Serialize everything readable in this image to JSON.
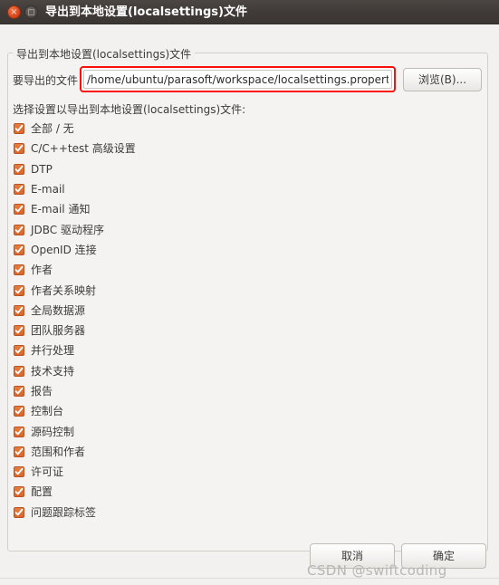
{
  "window": {
    "title": "导出到本地设置(localsettings)文件",
    "close_icon": "close-icon",
    "maximize_icon": "maximize-icon",
    "close_glyph": "×"
  },
  "group": {
    "legend": "导出到本地设置(localsettings)文件"
  },
  "path_field": {
    "label": "要导出的文件",
    "value": "/home/ubuntu/parasoft/workspace/localsettings.properties",
    "placeholder": "",
    "highlight_color": "#fa0f0a"
  },
  "browse_button": {
    "label": "浏览(B)..."
  },
  "instruction": "选择设置以导出到本地设置(localsettings)文件:",
  "checkboxes": {
    "accent_color": "#d9662c",
    "items": [
      {
        "label": "全部 / 无",
        "checked": true
      },
      {
        "label": "C/C++test 高级设置",
        "checked": true
      },
      {
        "label": "DTP",
        "checked": true
      },
      {
        "label": "E-mail",
        "checked": true
      },
      {
        "label": "E-mail 通知",
        "checked": true
      },
      {
        "label": "JDBC 驱动程序",
        "checked": true
      },
      {
        "label": "OpenID 连接",
        "checked": true
      },
      {
        "label": "作者",
        "checked": true
      },
      {
        "label": "作者关系映射",
        "checked": true
      },
      {
        "label": "全局数据源",
        "checked": true
      },
      {
        "label": "团队服务器",
        "checked": true
      },
      {
        "label": "并行处理",
        "checked": true
      },
      {
        "label": "技术支持",
        "checked": true
      },
      {
        "label": "报告",
        "checked": true
      },
      {
        "label": "控制台",
        "checked": true
      },
      {
        "label": "源码控制",
        "checked": true
      },
      {
        "label": "范围和作者",
        "checked": true
      },
      {
        "label": "许可证",
        "checked": true
      },
      {
        "label": "配置",
        "checked": true
      },
      {
        "label": "问题跟踪标签",
        "checked": true
      }
    ]
  },
  "footer": {
    "cancel_label": "取消",
    "ok_label": "确定"
  },
  "watermark": "CSDN @swiftcoding"
}
